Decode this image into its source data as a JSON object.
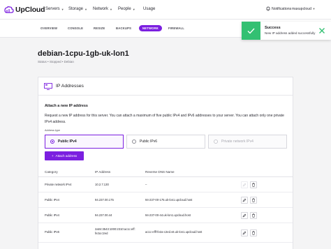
{
  "nav": {
    "brand": "UpCloud",
    "links": [
      {
        "label": "Servers",
        "dropdown": true
      },
      {
        "label": "Storage",
        "dropdown": true
      },
      {
        "label": "Network",
        "dropdown": true
      },
      {
        "label": "People",
        "dropdown": true
      },
      {
        "label": "Usage",
        "dropdown": false
      }
    ],
    "notifications": "Notifications",
    "username": "maxupcloud"
  },
  "tabs": [
    {
      "label": "OVERVIEW",
      "active": false
    },
    {
      "label": "CONSOLE",
      "active": false
    },
    {
      "label": "RESIZE",
      "active": false
    },
    {
      "label": "BACKUPS",
      "active": false
    },
    {
      "label": "NETWORK",
      "active": true
    },
    {
      "label": "FIREWALL",
      "active": false
    }
  ],
  "toast": {
    "title": "Success",
    "message": "New IP address added successfully"
  },
  "server": {
    "name": "debian-1cpu-1gb-uk-lon1",
    "breadcrumb": "Status • Stopped • Debian"
  },
  "card": {
    "title": "IP Addresses",
    "section_title": "Attach a new IP address",
    "description": "Request a new IP address for this server. You can attach a maximum of five public IPv4 and IPv6 addresses to your server. You can attach only one private IPv4 address.",
    "field_label": "Address type",
    "options": [
      {
        "label": "Public IPv4",
        "selected": true,
        "disabled": false
      },
      {
        "label": "Public IPv6",
        "selected": false,
        "disabled": false
      },
      {
        "label": "Private network IPv4",
        "selected": false,
        "disabled": true
      }
    ],
    "attach_label": "Attach address"
  },
  "table": {
    "headers": {
      "category": "Category",
      "ip": "IP Address",
      "dns": "Reverse DNS Name"
    },
    "rows": [
      {
        "category": "Private network IPv4",
        "ip": "10.2.7.130",
        "dns": "–",
        "edit_enabled": false
      },
      {
        "category": "Public IPv4",
        "ip": "94.237.00.175",
        "dns": "94-237-00-175.uk-lon1.upcloud.host",
        "edit_enabled": true
      },
      {
        "category": "Public IPv4",
        "ip": "94.237.00.44",
        "dns": "94-237-00-44.uk-lon1.upcloud.host",
        "edit_enabled": true
      },
      {
        "category": "Public IPv6",
        "ip": "2a04:3543:1000:2310:ac1c:eff:fe2a:c2ed",
        "dns": "ac1c-efff-fe2a-c2ed.v6.uk-lon1.upcloud.host",
        "edit_enabled": true
      }
    ]
  },
  "colors": {
    "accent": "#7b1fe0",
    "success": "#33c072"
  }
}
